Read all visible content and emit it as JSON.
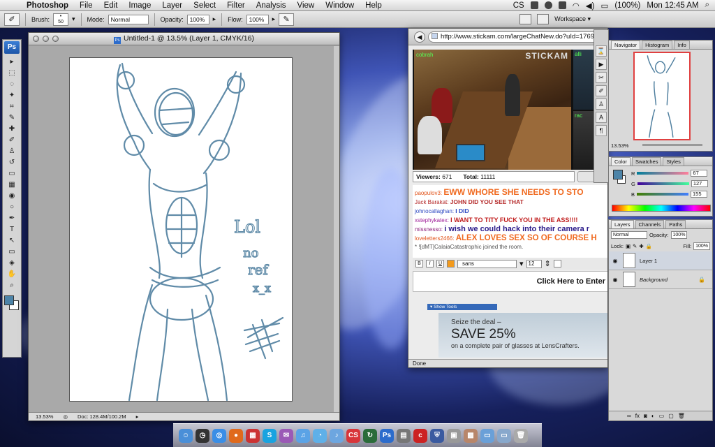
{
  "menubar": {
    "apple": "",
    "items": [
      "Photoshop",
      "File",
      "Edit",
      "Image",
      "Layer",
      "Select",
      "Filter",
      "Analysis",
      "View",
      "Window",
      "Help"
    ],
    "battery": "(100%)",
    "clock": "Mon 12:45 AM",
    "cs_label": "CS"
  },
  "options": {
    "brush_label": "Brush:",
    "brush_size": "50",
    "mode_label": "Mode:",
    "mode_value": "Normal",
    "opacity_label": "Opacity:",
    "opacity_value": "100%",
    "flow_label": "Flow:",
    "flow_value": "100%",
    "workspace_label": "Workspace ▾"
  },
  "tools": {
    "logo": "Ps",
    "icons": [
      "move-icon",
      "marquee-icon",
      "lasso-icon",
      "quick-select-icon",
      "crop-icon",
      "eyedropper-icon",
      "healing-icon",
      "brush-icon",
      "stamp-icon",
      "history-brush-icon",
      "eraser-icon",
      "gradient-icon",
      "blur-icon",
      "dodge-icon",
      "pen-icon",
      "type-icon",
      "path-select-icon",
      "shape-icon",
      "3d-icon",
      "hand-icon",
      "zoom-icon"
    ],
    "glyphs": [
      "▸",
      "⬚",
      "◌",
      "✦",
      "⌗",
      "✎",
      "✚",
      "✐",
      "♙",
      "↺",
      "▭",
      "▦",
      "◉",
      "○",
      "✒",
      "T",
      "↖",
      "▭",
      "◈",
      "✋",
      "⌕"
    ],
    "fg_color": "#4d84a8",
    "bg_color": "#ffffff"
  },
  "document": {
    "title": "Untitled-1 @ 13.5% (Layer 1, CMYK/16)",
    "zoom": "13.53%",
    "doc_size": "Doc: 128.4M/100.2M",
    "sketch_stroke": "#4f7f9f",
    "sketch_text": [
      "Lol",
      "no",
      "ref",
      "x_x"
    ]
  },
  "browser": {
    "url": "http://www.stickam.com/largeChatNew.do?uId=17693",
    "cam_labels": [
      "cobrah",
      "alli",
      "rac"
    ],
    "cam_logo": "STICKAM",
    "viewers_label": "Viewers:",
    "viewers_value": "671",
    "total_label": "Total:",
    "total_value": "11111",
    "chat": [
      {
        "user": "paopulov3:",
        "msg": "EWW WHORE SHE NEEDS TO STO",
        "ucolor": "#e2541b",
        "mcolor": "#f06a20",
        "size": "12px"
      },
      {
        "user": "Jack Barakat:",
        "msg": "JOHN DID YOU SEE THAT",
        "ucolor": "#b52a2a",
        "mcolor": "#b52a2a",
        "size": "8.5px"
      },
      {
        "user": "johnocallaghan:",
        "msg": "I DID",
        "ucolor": "#2c48c2",
        "mcolor": "#2c48c2",
        "size": "8.5px"
      },
      {
        "user": "xstephykatex:",
        "msg": "I WANT TO TITY FUCK YOU IN THE ASS!!!!",
        "ucolor": "#a0229a",
        "mcolor": "#c01d1d",
        "size": "9px"
      },
      {
        "user": "missnesso:",
        "msg": "i wish we could hack into their camera r",
        "ucolor": "#8a1b7a",
        "mcolor": "#2a1a8a",
        "size": "11px"
      },
      {
        "user": "loveletters2466:",
        "msg": "ALEX LOVES SEX SO OF COURSE H",
        "ucolor": "#e2541b",
        "mcolor": "#f06a20",
        "size": "11.5px"
      }
    ],
    "system_msg": "* ![dMT]CalaiaCatastrophic joined the room.",
    "font_value": "sans",
    "size_value": "12",
    "enter_text": "Click Here to Enter",
    "show_tools": "▾ Show Tools",
    "ad_line1": "Seize the deal –",
    "ad_line2": "SAVE 25%",
    "ad_line3": "on a complete pair of glasses at LensCrafters.",
    "status": "Done"
  },
  "navigator": {
    "tabs": [
      "Navigator",
      "Histogram",
      "Info"
    ],
    "zoom": "13.53%"
  },
  "color_panel": {
    "tabs": [
      "Color",
      "Swatches",
      "Styles"
    ],
    "r_label": "R",
    "r_value": "67",
    "g_label": "G",
    "g_value": "127",
    "b_label": "B",
    "b_value": "155",
    "swatch": "#4d84a8"
  },
  "layers_panel": {
    "tabs": [
      "Layers",
      "Channels",
      "Paths"
    ],
    "blend": "Normal",
    "opacity_label": "Opacity:",
    "opacity_value": "100%",
    "lock_label": "Lock:",
    "fill_label": "Fill:",
    "fill_value": "100%",
    "layers": [
      "Layer 1",
      "Background"
    ]
  },
  "dock": {
    "icons": [
      {
        "name": "finder-icon",
        "color": "#4a8fd8",
        "glyph": "☺"
      },
      {
        "name": "dashboard-icon",
        "color": "#333",
        "glyph": "◷"
      },
      {
        "name": "safari-icon",
        "color": "#3a8ee6",
        "glyph": "◎"
      },
      {
        "name": "firefox-icon",
        "color": "#e06a1c",
        "glyph": "●"
      },
      {
        "name": "ical-icon",
        "color": "#c33",
        "glyph": "▦"
      },
      {
        "name": "skype-icon",
        "color": "#19a3e0",
        "glyph": "S"
      },
      {
        "name": "messages-icon",
        "color": "#9b59b6",
        "glyph": "✉"
      },
      {
        "name": "itunes-icon",
        "color": "#5ba3e6",
        "glyph": "♫"
      },
      {
        "name": "ichat-icon",
        "color": "#5fb0e8",
        "glyph": "◔"
      },
      {
        "name": "music-icon",
        "color": "#6da6e0",
        "glyph": "♪"
      },
      {
        "name": "creative-suite-icon",
        "color": "#d8353a",
        "glyph": "CS"
      },
      {
        "name": "time-machine-icon",
        "color": "#2a6c3a",
        "glyph": "↻"
      },
      {
        "name": "photoshop-icon",
        "color": "#2c6ccc",
        "glyph": "Ps"
      },
      {
        "name": "app-icon",
        "color": "#777",
        "glyph": "▤"
      },
      {
        "name": "cisco-icon",
        "color": "#cc2222",
        "glyph": "c"
      },
      {
        "name": "shield-icon",
        "color": "#3a5aa0",
        "glyph": "⛨"
      },
      {
        "name": "preview-icon",
        "color": "#999",
        "glyph": "▣"
      },
      {
        "name": "photo-icon",
        "color": "#b8866a",
        "glyph": "▩"
      },
      {
        "name": "folder-icon",
        "color": "#6aa0d8",
        "glyph": "▭"
      },
      {
        "name": "documents-icon",
        "color": "#88a8cc",
        "glyph": "▭"
      },
      {
        "name": "trash-icon",
        "color": "#aaa",
        "glyph": "🗑"
      }
    ]
  }
}
